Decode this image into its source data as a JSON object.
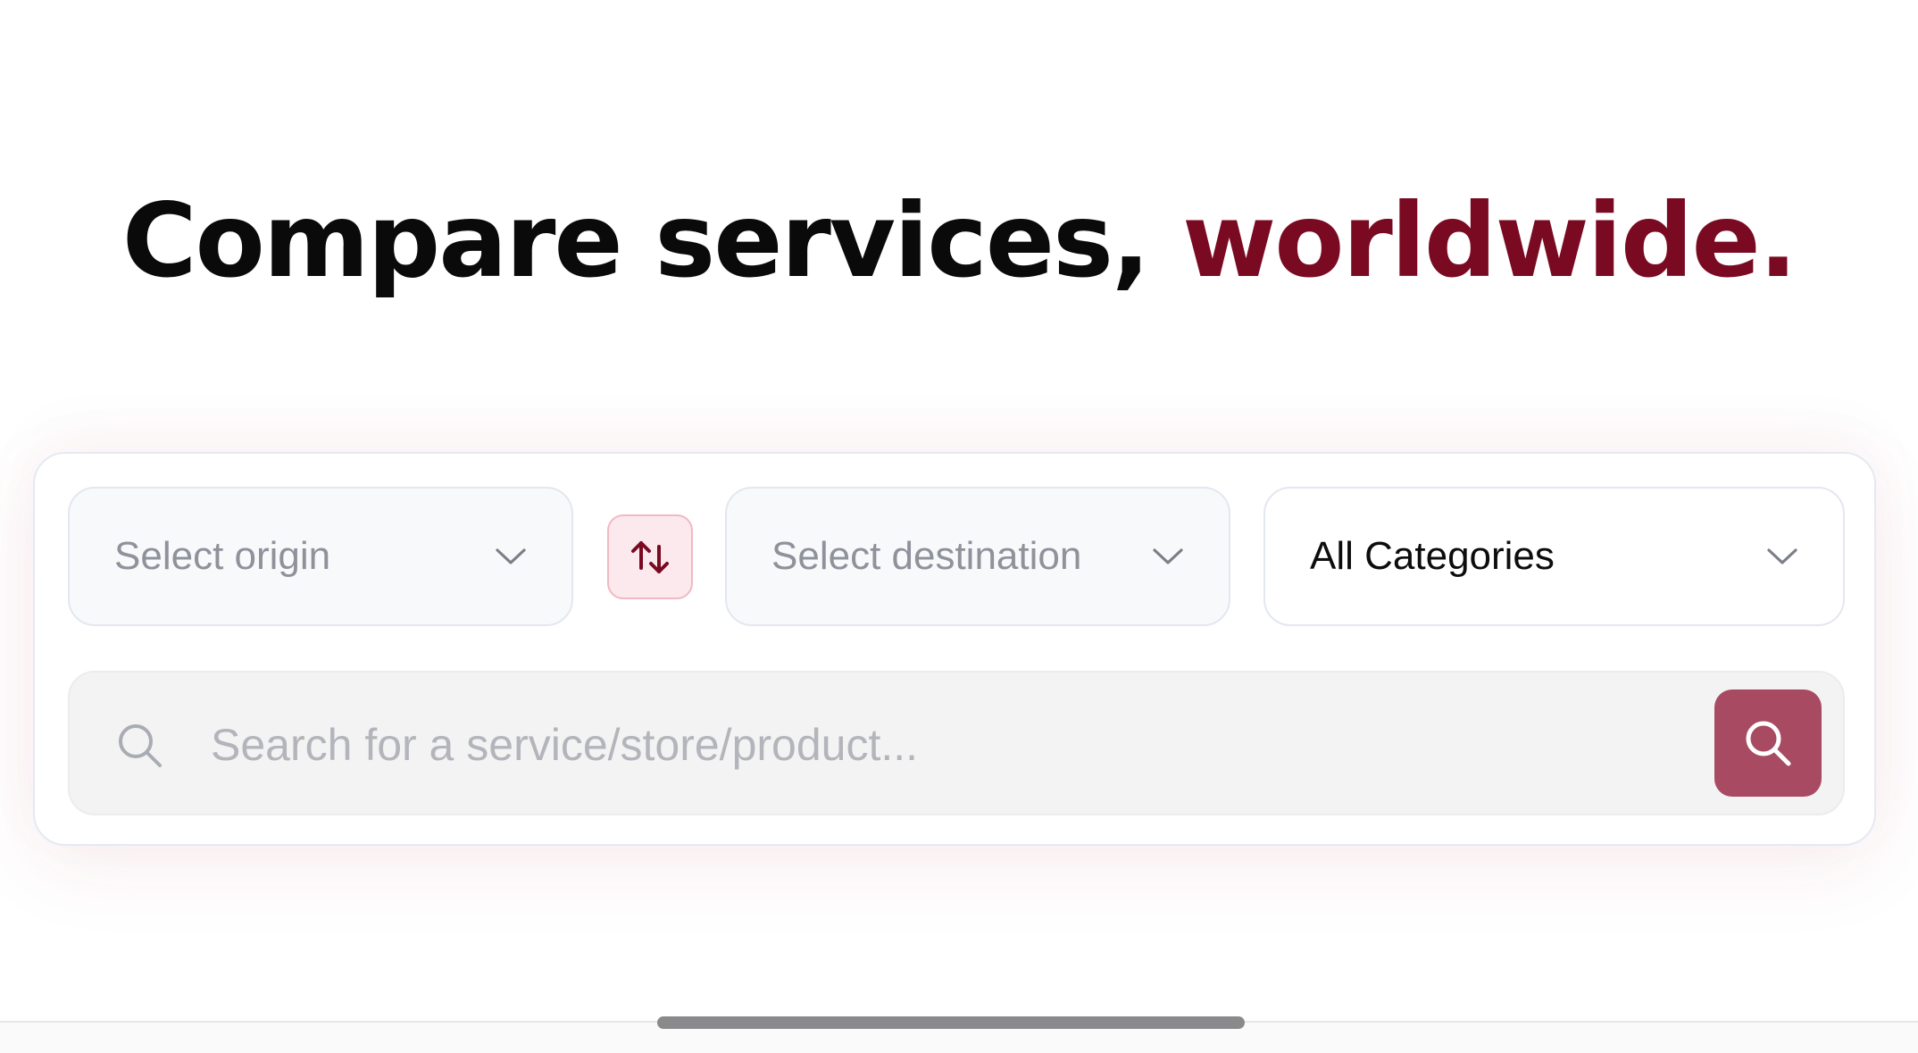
{
  "headline": {
    "prefix": "Compare services, ",
    "accent": "worldwide."
  },
  "filters": {
    "origin": {
      "placeholder": "Select origin",
      "icon": "chevron-down-icon"
    },
    "swap": {
      "icon": "swap-arrows-icon"
    },
    "destination": {
      "placeholder": "Select destination",
      "icon": "chevron-down-icon"
    },
    "category": {
      "value": "All Categories",
      "icon": "chevron-down-icon"
    }
  },
  "search": {
    "placeholder": "Search for a service/store/product...",
    "leading_icon": "search-icon",
    "button_icon": "search-icon"
  },
  "colors": {
    "accent": "#7a0a22",
    "button": "#a84a62",
    "swap_bg": "#fbe9ed"
  }
}
